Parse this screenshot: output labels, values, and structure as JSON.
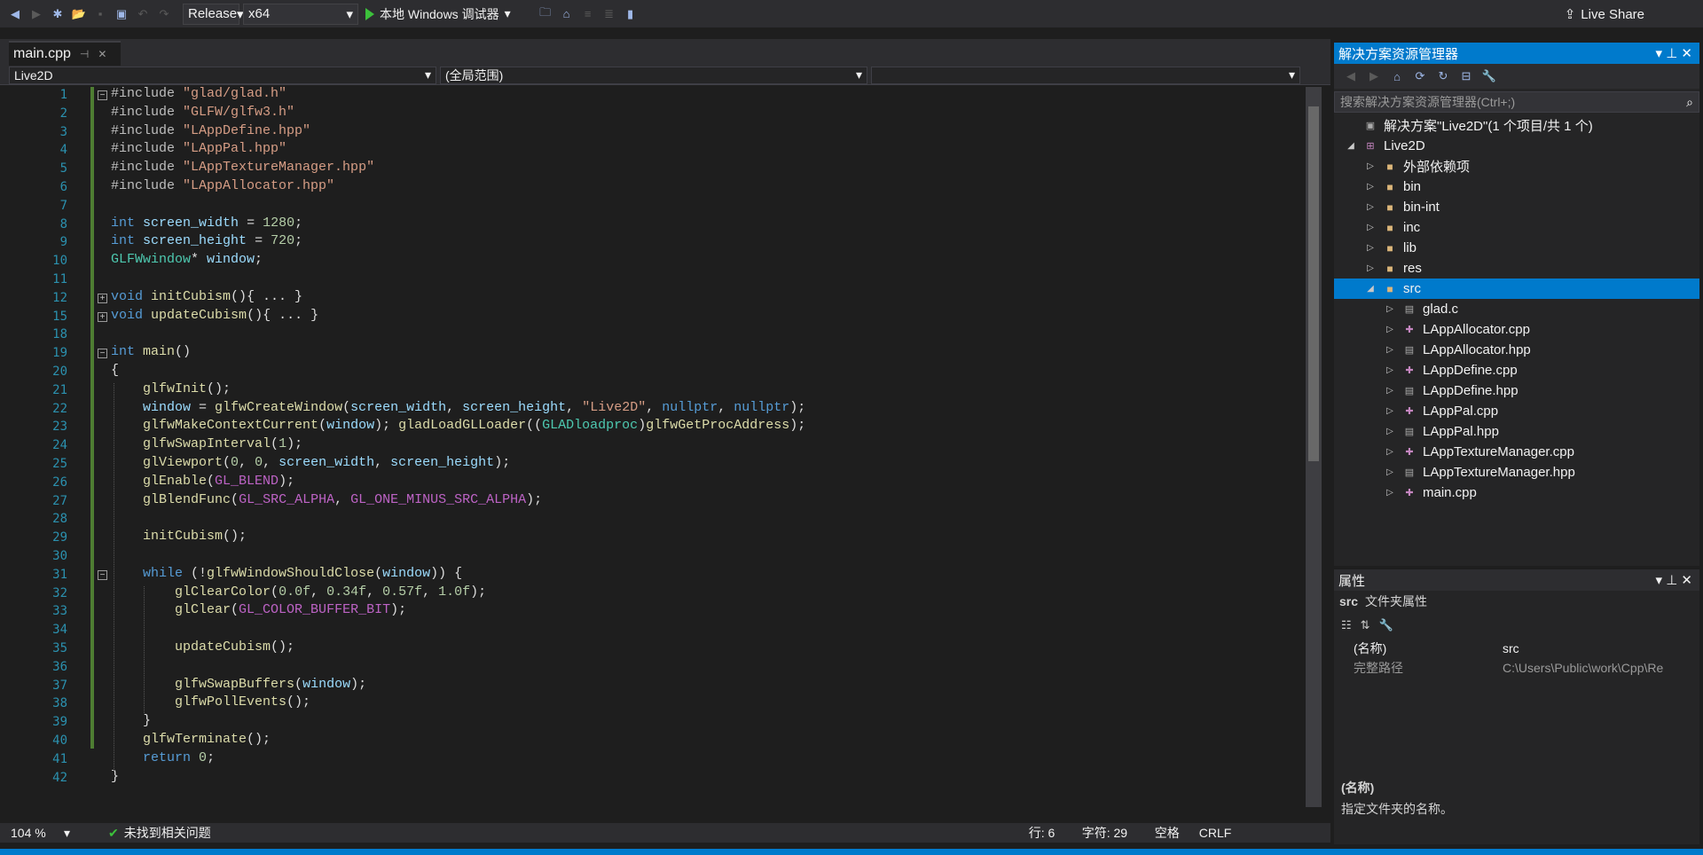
{
  "toolbar": {
    "config": "Release",
    "platform": "x64",
    "run_label": "本地 Windows 调试器",
    "live_share": "Live Share"
  },
  "editor": {
    "tab_label": "main.cpp",
    "nav_project": "Live2D",
    "nav_scope": "(全局范围)"
  },
  "status": {
    "zoom": "104 %",
    "issues": "未找到相关问题",
    "line": "行: 6",
    "col": "字符: 29",
    "spaces": "空格",
    "eol": "CRLF"
  },
  "solution": {
    "title": "解决方案资源管理器",
    "search_placeholder": "搜索解决方案资源管理器(Ctrl+;)",
    "root": "解决方案\"Live2D\"(1 个项目/共 1 个)",
    "project": "Live2D",
    "folders": [
      "外部依赖项",
      "bin",
      "bin-int",
      "inc",
      "lib",
      "res"
    ],
    "src": "src",
    "files": [
      "glad.c",
      "LAppAllocator.cpp",
      "LAppAllocator.hpp",
      "LAppDefine.cpp",
      "LAppDefine.hpp",
      "LAppPal.cpp",
      "LAppPal.hpp",
      "LAppTextureManager.cpp",
      "LAppTextureManager.hpp",
      "main.cpp"
    ]
  },
  "properties": {
    "title": "属性",
    "header_name": "src",
    "header_desc": "文件夹属性",
    "rows": [
      {
        "k": "(名称)",
        "v": "src"
      },
      {
        "k": "完整路径",
        "v": "C:\\Users\\Public\\work\\Cpp\\Re"
      }
    ],
    "desc_title": "(名称)",
    "desc_text": "指定文件夹的名称。"
  },
  "line_numbers": [
    "1",
    "2",
    "3",
    "4",
    "5",
    "6",
    "7",
    "8",
    "9",
    "10",
    "11",
    "12",
    "15",
    "18",
    "19",
    "20",
    "21",
    "22",
    "23",
    "24",
    "25",
    "26",
    "27",
    "28",
    "29",
    "30",
    "31",
    "32",
    "33",
    "34",
    "35",
    "36",
    "37",
    "38",
    "39",
    "40",
    "41",
    "42"
  ],
  "code_lines": [
    "#include \"glad/glad.h\"",
    "#include \"GLFW/glfw3.h\"",
    "#include \"LAppDefine.hpp\"",
    "#include \"LAppPal.hpp\"",
    "#include \"LAppTextureManager.hpp\"",
    "#include \"LAppAllocator.hpp\"",
    "",
    "int screen_width = 1280;",
    "int screen_height = 720;",
    "GLFWwindow* window;",
    "",
    "void initCubism(){ ... }",
    "void updateCubism(){ ... }",
    "",
    "int main()",
    "{",
    "    glfwInit();",
    "    window = glfwCreateWindow(screen_width, screen_height, \"Live2D\", nullptr, nullptr);",
    "    glfwMakeContextCurrent(window); gladLoadGLLoader((GLADloadproc)glfwGetProcAddress);",
    "    glfwSwapInterval(1);",
    "    glViewport(0, 0, screen_width, screen_height);",
    "    glEnable(GL_BLEND);",
    "    glBlendFunc(GL_SRC_ALPHA, GL_ONE_MINUS_SRC_ALPHA);",
    "",
    "    initCubism();",
    "",
    "    while (!glfwWindowShouldClose(window)) {",
    "        glClearColor(0.0f, 0.34f, 0.57f, 1.0f);",
    "        glClear(GL_COLOR_BUFFER_BIT);",
    "",
    "        updateCubism();",
    "",
    "        glfwSwapBuffers(window);",
    "        glfwPollEvents();",
    "    }",
    "    glfwTerminate();",
    "    return 0;",
    "}"
  ]
}
